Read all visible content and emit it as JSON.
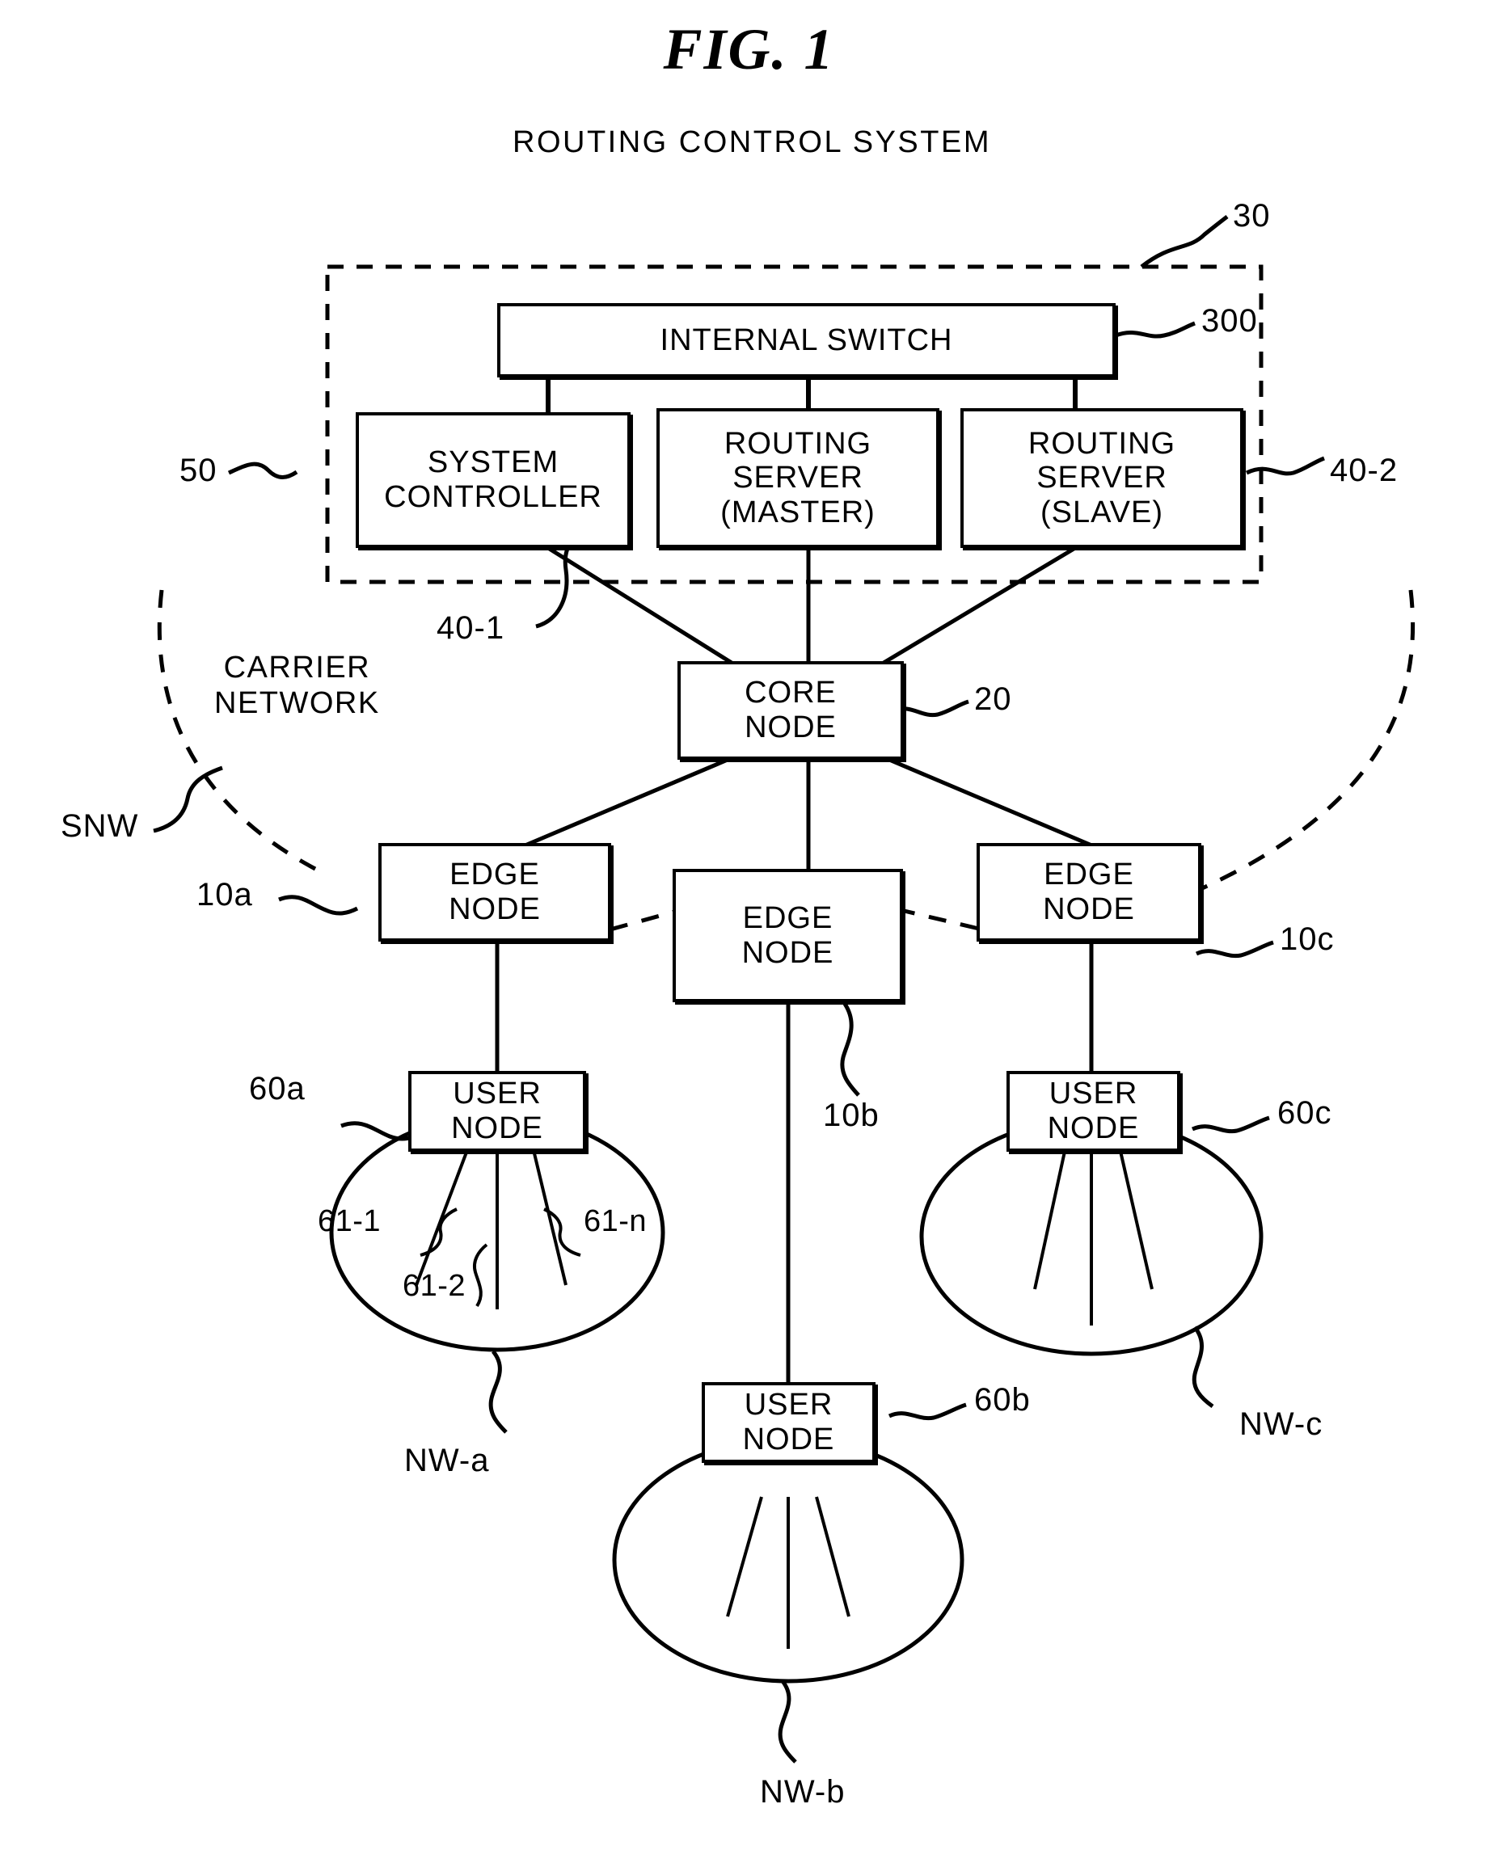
{
  "figure": {
    "title": "FIG. 1",
    "system_caption": "ROUTING CONTROL SYSTEM"
  },
  "boxes": {
    "internal_switch": "INTERNAL SWITCH",
    "system_controller": "SYSTEM\nCONTROLLER",
    "routing_server_master": "ROUTING\nSERVER\n(MASTER)",
    "routing_server_slave": "ROUTING\nSERVER\n(SLAVE)",
    "core_node": "CORE\nNODE",
    "edge_node_a": "EDGE\nNODE",
    "edge_node_b": "EDGE\nNODE",
    "edge_node_c": "EDGE\nNODE",
    "user_node_a": "USER\nNODE",
    "user_node_b": "USER\nNODE",
    "user_node_c": "USER\nNODE"
  },
  "reference_numerals": {
    "routing_control_system": "30",
    "internal_switch": "300",
    "system_controller": "50",
    "routing_server_master": "40-1",
    "routing_server_slave": "40-2",
    "core_node": "20",
    "edge_node_a": "10a",
    "edge_node_b": "10b",
    "edge_node_c": "10c",
    "user_node_a": "60a",
    "user_node_b": "60b",
    "user_node_c": "60c",
    "terminal_1": "61-1",
    "terminal_2": "61-2",
    "terminal_n": "61-n"
  },
  "network_labels": {
    "carrier_network": "CARRIER\nNETWORK",
    "carrier_network_ref": "SNW",
    "network_a": "NW-a",
    "network_b": "NW-b",
    "network_c": "NW-c"
  },
  "colors": {
    "line": "#000000",
    "background": "#ffffff"
  }
}
